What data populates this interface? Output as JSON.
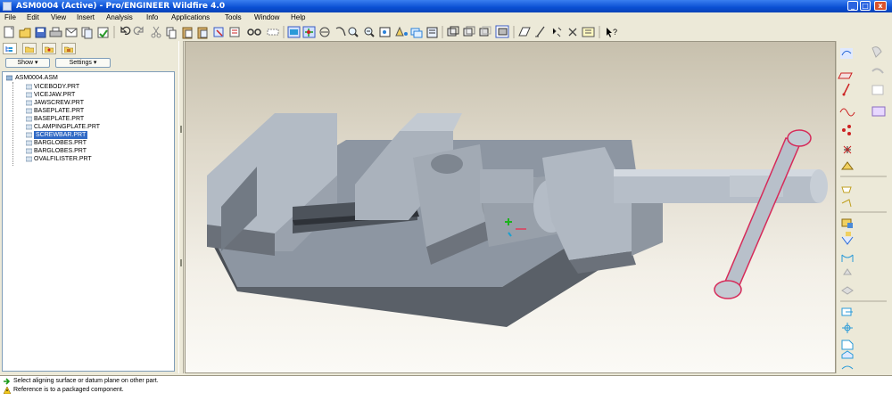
{
  "window": {
    "title": "ASM0004 (Active) - Pro/ENGINEER Wildfire 4.0",
    "controls": {
      "minimize": "_",
      "maximize": "□",
      "close": "x"
    }
  },
  "menu": [
    "File",
    "Edit",
    "View",
    "Insert",
    "Analysis",
    "Info",
    "Applications",
    "Tools",
    "Window",
    "Help"
  ],
  "toolbar_icons": [
    "new-icon",
    "open-icon",
    "save-icon",
    "print-icon",
    "email-icon",
    "copy-icon",
    "regenerate-icon",
    "undo-icon",
    "redo-icon",
    "cut-icon",
    "copy2-icon",
    "paste-icon",
    "paste-special-icon",
    "select-icon",
    "find-icon",
    "datum-plane-icon",
    "datum-axis-icon",
    "repaint-icon",
    "spin-center-icon",
    "orient-icon",
    "zoom-in-icon",
    "zoom-out-icon",
    "refit-icon",
    "reorient-icon",
    "saved-views-icon",
    "layers-icon",
    "view-manager-icon",
    "shading-icon",
    "hidden-line-icon",
    "no-hidden-icon",
    "wireframe-icon",
    "datum-planes-toggle-icon",
    "datum-axes-toggle-icon",
    "datum-points-toggle-icon",
    "csys-toggle-icon",
    "annotations-icon",
    "whats-this-icon"
  ],
  "left_panel": {
    "tabs": [
      "model-tree-tab",
      "folder-browser-tab",
      "favorites-tab",
      "connections-tab"
    ],
    "show_label": "Show ▾",
    "settings_label": "Settings ▾",
    "tree": {
      "root": "ASM0004.ASM",
      "items": [
        {
          "label": "VICEBODY.PRT",
          "selected": false
        },
        {
          "label": "VICEJAW.PRT",
          "selected": false
        },
        {
          "label": "JAWSCREW.PRT",
          "selected": false
        },
        {
          "label": "BASEPLATE.PRT",
          "selected": false
        },
        {
          "label": "BASEPLATE.PRT",
          "selected": false
        },
        {
          "label": "CLAMPINGPLATE.PRT",
          "selected": false
        },
        {
          "label": "SCREWBAR.PRT",
          "selected": true
        },
        {
          "label": "BARGLOBES.PRT",
          "selected": false
        },
        {
          "label": "BARGLOBES.PRT",
          "selected": false
        },
        {
          "label": "OVALFILISTER.PRT",
          "selected": false
        }
      ]
    }
  },
  "right_toolbar_icons": [
    "sketch-icon",
    "plane-icon",
    "axis-icon",
    "curve-icon",
    "point-icon",
    "csys-icon",
    "analysis-icon",
    "extrude-icon",
    "revolve-icon",
    "sweep-icon",
    "blend-icon",
    "hole-icon",
    "shell-icon",
    "rib-icon",
    "draft-icon",
    "round-icon",
    "chamfer-icon",
    "pattern-icon",
    "mirror-icon",
    "merge-icon",
    "trim-icon",
    "offset-icon",
    "thicken-icon",
    "solidify-icon"
  ],
  "messages": [
    {
      "icon": "info-arrow-icon",
      "text": "Select aligning surface or datum plane on other part."
    },
    {
      "icon": "warning-icon",
      "text": "Reference is to a packaged component."
    }
  ],
  "colors": {
    "titlebar": "#0a4fd3",
    "selection": "#316ac5",
    "part_steel": "#a9b1bc",
    "highlight": "#d62b5a"
  }
}
